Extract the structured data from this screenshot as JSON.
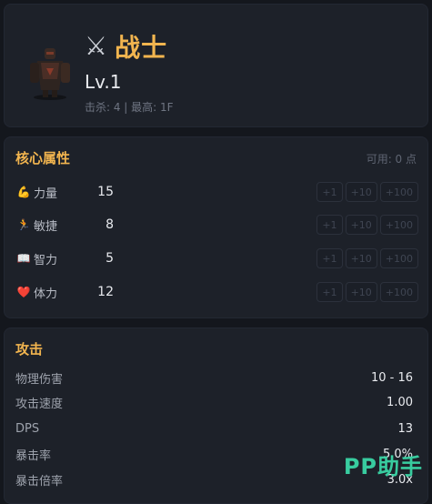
{
  "hero": {
    "name": "战士",
    "level": "Lv.1",
    "sub": "击杀: 4 | 最高: 1F",
    "class_icon": "crossed-swords-icon"
  },
  "attributes": {
    "title": "核心属性",
    "available": "可用: 0 点",
    "buttons": [
      "+1",
      "+10",
      "+100"
    ],
    "stats": [
      {
        "icon": "💪",
        "label": "力量",
        "value": "15",
        "icon_name": "flexed-arm-icon"
      },
      {
        "icon": "🏃",
        "label": "敏捷",
        "value": "8",
        "icon_name": "running-icon"
      },
      {
        "icon": "📖",
        "label": "智力",
        "value": "5",
        "icon_name": "book-icon"
      },
      {
        "icon": "❤️",
        "label": "体力",
        "value": "12",
        "icon_name": "heart-icon"
      }
    ]
  },
  "attack": {
    "title": "攻击",
    "rows": [
      {
        "label": "物理伤害",
        "value": "10 - 16"
      },
      {
        "label": "攻击速度",
        "value": "1.00"
      },
      {
        "label": "DPS",
        "value": "13"
      },
      {
        "label": "暴击率",
        "value": "5.0%"
      },
      {
        "label": "暴击倍率",
        "value": "3.0x"
      }
    ]
  },
  "watermark": "PP助手",
  "colors": {
    "accent": "#f2b54f",
    "panel": "#1d2129",
    "background": "#14171d",
    "watermark": "#3ad6a6"
  }
}
